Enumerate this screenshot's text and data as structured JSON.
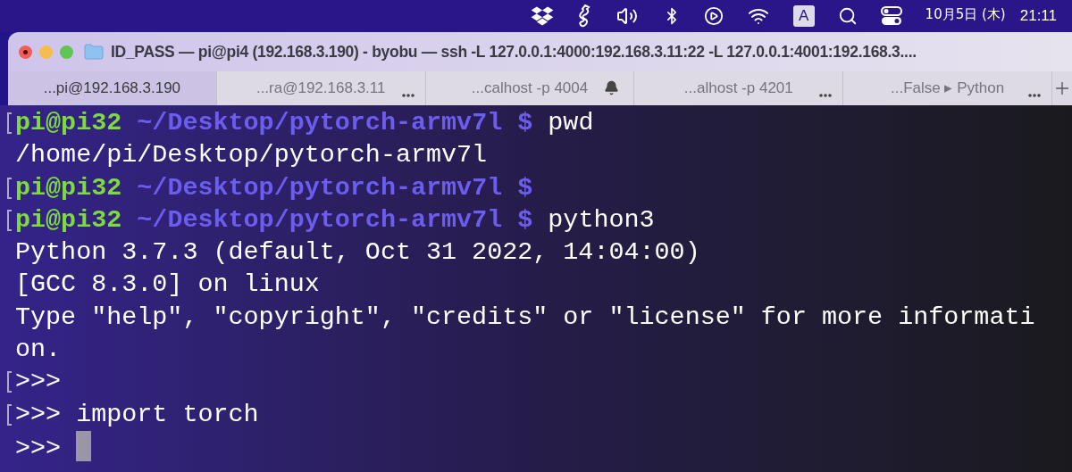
{
  "menu_bar": {
    "input_source": "A",
    "date": "10月5日 (木)",
    "time": "21:11"
  },
  "window": {
    "title": "ID_PASS — pi@pi4 (192.168.3.190) - byobu — ssh -L 127.0.0.1:4000:192.168.3.11:22 -L 127.0.0.1:4001:192.168.3...."
  },
  "tabs": [
    {
      "label": "...pi@192.168.3.190",
      "selected": true,
      "kind": "plain"
    },
    {
      "label": "...ra@192.168.3.11",
      "selected": false,
      "kind": "activity"
    },
    {
      "label": "...calhost -p 4004",
      "selected": false,
      "kind": "bell"
    },
    {
      "label": "...alhost -p 4201",
      "selected": false,
      "kind": "activity"
    },
    {
      "label": "...False ▸ Python",
      "selected": false,
      "kind": "activity"
    }
  ],
  "terminal": {
    "lines": [
      {
        "kind": "prompt",
        "marked": true,
        "user": "pi@pi32",
        "path": "~/Desktop/pytorch-armv7l $",
        "command": "pwd"
      },
      {
        "kind": "output",
        "marked": false,
        "text": "/home/pi/Desktop/pytorch-armv7l"
      },
      {
        "kind": "prompt",
        "marked": true,
        "user": "pi@pi32",
        "path": "~/Desktop/pytorch-armv7l $"
      },
      {
        "kind": "prompt",
        "marked": true,
        "user": "pi@pi32",
        "path": "~/Desktop/pytorch-armv7l $",
        "command": "python3"
      },
      {
        "kind": "output",
        "marked": false,
        "text": "Python 3.7.3 (default, Oct 31 2022, 14:04:00)"
      },
      {
        "kind": "output",
        "marked": false,
        "text": "[GCC 8.3.0] on linux"
      },
      {
        "kind": "output",
        "marked": false,
        "text": "Type \"help\", \"copyright\", \"credits\" or \"license\" for more informati"
      },
      {
        "kind": "output",
        "marked": false,
        "text": "on."
      },
      {
        "kind": "output",
        "marked": true,
        "text": ">>>"
      },
      {
        "kind": "output",
        "marked": true,
        "text": ">>> import torch"
      },
      {
        "kind": "output",
        "marked": false,
        "text": ">>> ",
        "cursor": true
      }
    ]
  }
}
